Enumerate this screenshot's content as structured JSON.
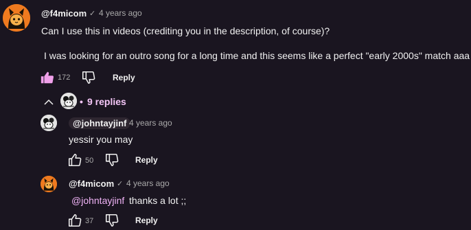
{
  "top_comment": {
    "author": "@f4micom",
    "verified_mark": "✓",
    "time": "4 years ago",
    "line1": "Can I use this in videos (crediting you in the description, of course)?",
    "line2": "I was looking for an outro song for a long time and this seems like a perfect \"early 2000s\" match aaa",
    "likes": "172",
    "reply_label": "Reply",
    "avatar_icon": "cat-avatar-orange"
  },
  "replies_toggle": {
    "icon": "chevron-up-icon",
    "dot": "•",
    "label": "9 replies",
    "avatar_icon": "creator-avatar-bw"
  },
  "replies": [
    {
      "author": "@johntayjinf",
      "time": "4 years ago",
      "text": "yessir you may",
      "likes": "50",
      "reply_label": "Reply",
      "avatar_icon": "creator-avatar-bw"
    },
    {
      "author": "@f4micom",
      "verified_mark": "✓",
      "time": "4 years ago",
      "mention": "@johntayjinf",
      "text": "thanks a lot ;;",
      "likes": "37",
      "reply_label": "Reply",
      "avatar_icon": "cat-avatar-orange"
    }
  ],
  "colors": {
    "background": "#1a1520",
    "liked_thumb": "#f0a0ea",
    "mention": "#f0b3f6",
    "replies_link": "#f4c6f7",
    "avatar_orange": "#e9741b"
  }
}
